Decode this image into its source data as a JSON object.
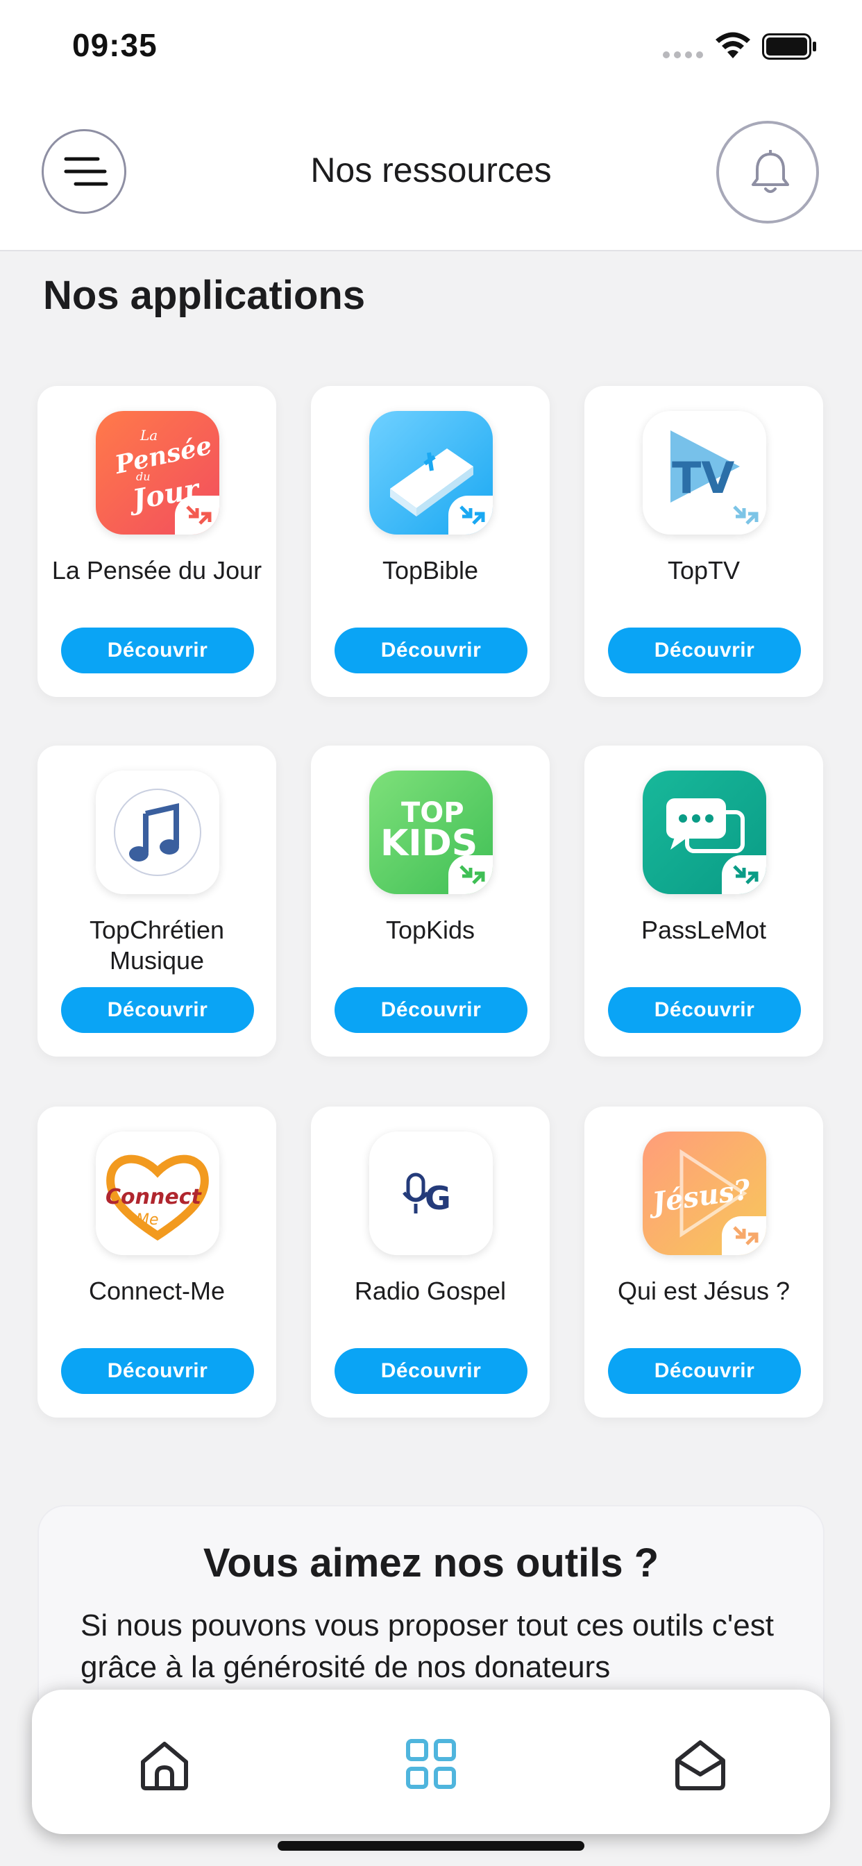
{
  "status_bar": {
    "time": "09:35"
  },
  "header": {
    "title": "Nos ressources"
  },
  "section": {
    "title": "Nos applications"
  },
  "apps": [
    {
      "name": "La Pensée du Jour",
      "button": "Découvrir",
      "icon": "la-pensee-du-jour-icon",
      "icon_text": [
        "La",
        "Pensée",
        "du",
        "Jour"
      ]
    },
    {
      "name": "TopBible",
      "button": "Découvrir",
      "icon": "bible-icon"
    },
    {
      "name": "TopTV",
      "button": "Découvrir",
      "icon": "toptv-icon",
      "icon_text": "TV"
    },
    {
      "name": "TopChrétien Musique",
      "button": "Découvrir",
      "icon": "music-note-icon"
    },
    {
      "name": "TopKids",
      "button": "Découvrir",
      "icon": "topkids-icon",
      "icon_text": [
        "TOP",
        "KIDS"
      ]
    },
    {
      "name": "PassLeMot",
      "button": "Découvrir",
      "icon": "chat-bubbles-icon"
    },
    {
      "name": "Connect-Me",
      "button": "Découvrir",
      "icon": "connect-me-icon",
      "icon_text": [
        "Connect",
        "Me"
      ]
    },
    {
      "name": "Radio Gospel",
      "button": "Découvrir",
      "icon": "radio-gospel-icon",
      "icon_text": "G"
    },
    {
      "name": "Qui est Jésus ?",
      "button": "Découvrir",
      "icon": "qui-est-jesus-icon",
      "icon_text": "Jésus?"
    }
  ],
  "promo": {
    "title": "Vous aimez nos outils ?",
    "text": "Si nous pouvons vous proposer tout ces outils c'est grâce à la générosité de nos donateurs"
  },
  "nav": {
    "items": [
      {
        "icon": "home-icon",
        "active": false
      },
      {
        "icon": "grid-icon",
        "active": true
      },
      {
        "icon": "inbox-icon",
        "active": false
      }
    ]
  },
  "colors": {
    "accent": "#0aa4f5",
    "active_nav": "#4fb5dd",
    "background": "#f2f2f3"
  }
}
